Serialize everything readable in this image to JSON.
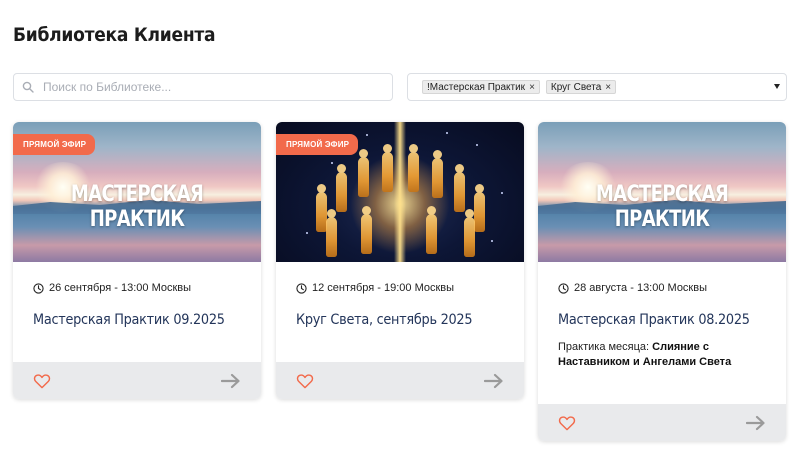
{
  "page": {
    "title": "Библиотека Клиента"
  },
  "search": {
    "placeholder": "Поиск по Библиотеке..."
  },
  "filter": {
    "tags": [
      "!Мастерская Практик",
      "Круг Света"
    ],
    "remove_glyph": "×"
  },
  "cards": [
    {
      "badge": "ПРЯМОЙ ЭФИР",
      "image_title": "МАСТЕРСКАЯ ПРАКТИК",
      "date": "26 сентября - 13:00 Москвы",
      "title": "Мастерская Практик 09.2025"
    },
    {
      "badge": "ПРЯМОЙ ЭФИР",
      "date": "12 сентября - 19:00 Москвы",
      "title": "Круг Света, сентябрь 2025"
    },
    {
      "image_title": "МАСТЕРСКАЯ ПРАКТИК",
      "date": "28 августа - 13:00 Москвы",
      "title": "Мастерская Практик 08.2025",
      "desc_prefix": "Практика месяца: ",
      "desc_bold": "Слияние с Наставником и Ангелами Света"
    }
  ],
  "colors": {
    "badge": "#f26a4b",
    "heart": "#f26a4b",
    "arrow": "#9a9a9a",
    "title_text": "#23355a",
    "footer_bg": "#e9eaec"
  },
  "icons": {
    "search": "search-icon",
    "clock": "clock-icon",
    "heart": "heart-icon",
    "arrow": "arrow-right-icon",
    "caret": "caret-down-icon"
  }
}
